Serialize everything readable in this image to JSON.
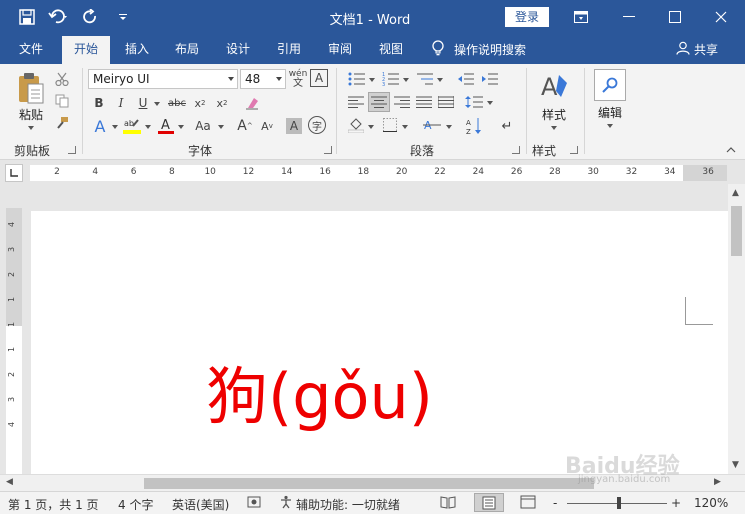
{
  "window": {
    "title": "文档1 - Word",
    "login_label": "登录"
  },
  "colors": {
    "brand": "#2b579a",
    "ribbon_bg": "#f3f3f3",
    "doc_text": "#ee0000"
  },
  "tabs": [
    {
      "label": "文件",
      "active": false
    },
    {
      "label": "开始",
      "active": true
    },
    {
      "label": "插入",
      "active": false
    },
    {
      "label": "布局",
      "active": false
    },
    {
      "label": "设计",
      "active": false
    },
    {
      "label": "引用",
      "active": false
    },
    {
      "label": "审阅",
      "active": false
    },
    {
      "label": "视图",
      "active": false
    }
  ],
  "tell_me": "操作说明搜索",
  "share_label": "共享",
  "ribbon": {
    "clipboard": {
      "paste_label": "粘贴",
      "group_label": "剪贴板"
    },
    "font": {
      "font_name": "Meiryo UI",
      "font_size": "48",
      "phonetic_label": "wén",
      "group_label": "字体"
    },
    "paragraph": {
      "group_label": "段落"
    },
    "styles": {
      "label": "样式",
      "group_label": "样式"
    },
    "editing": {
      "label": "编辑"
    }
  },
  "ruler": {
    "h_ticks": [
      "2",
      "4",
      "6",
      "8",
      "10",
      "12",
      "14",
      "16",
      "18",
      "20",
      "22",
      "24",
      "26",
      "28",
      "30",
      "32",
      "34",
      "36"
    ],
    "v_ticks": [
      "4",
      "3",
      "2",
      "1",
      "1",
      "1",
      "2",
      "3",
      "4"
    ]
  },
  "document": {
    "text": "狗(gǒu)"
  },
  "status": {
    "page": "第 1 页，共 1 页",
    "words": "4 个字",
    "language": "英语(美国)",
    "accessibility": "辅助功能: 一切就绪",
    "zoom_minus": "-",
    "zoom_plus": "+",
    "zoom": "120%"
  },
  "watermark": {
    "main": "Baidu经验",
    "sub": "jingyan.baidu.com"
  }
}
